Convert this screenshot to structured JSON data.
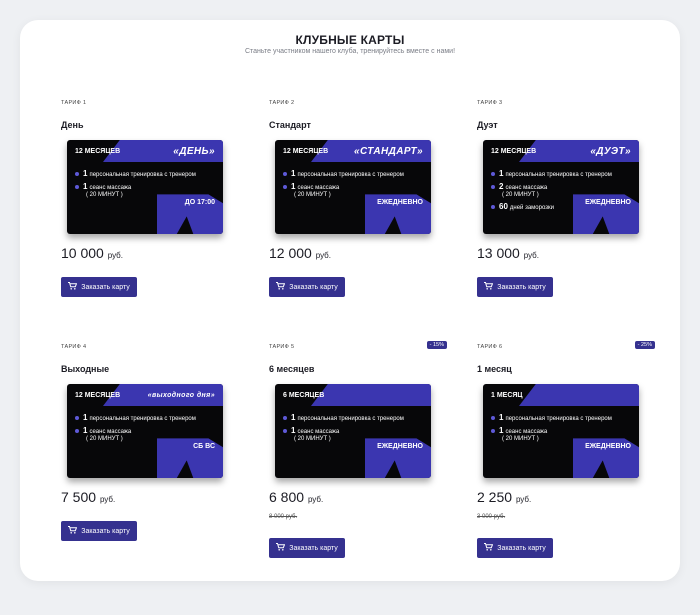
{
  "header": {
    "title": "КЛУБНЫЕ КАРТЫ",
    "subtitle": "Станьте участником нашего клуба, тренируйтесь вместе с нами!"
  },
  "tariffs": [
    {
      "tag": "ТАРИФ 1",
      "name": "День",
      "badge": "",
      "card": {
        "period": "12 МЕСЯЦЕВ",
        "plan": "«ДЕНЬ»",
        "items": [
          {
            "num": "1",
            "text": "персональная тренировка с тренером",
            "sub": ""
          },
          {
            "num": "1",
            "text": "сеанс массажа",
            "sub": "( 20 МИНУТ )"
          }
        ],
        "schedule": "ДО 17:00"
      },
      "price": "10 000",
      "currency": "руб.",
      "old_price": "",
      "button": "Заказать карту"
    },
    {
      "tag": "ТАРИФ 2",
      "name": "Стандарт",
      "badge": "",
      "card": {
        "period": "12 МЕСЯЦЕВ",
        "plan": "«СТАНДАРТ»",
        "items": [
          {
            "num": "1",
            "text": "персональная тренировка с тренером",
            "sub": ""
          },
          {
            "num": "1",
            "text": "сеанс массажа",
            "sub": "( 20 МИНУТ )"
          }
        ],
        "schedule": "ЕЖЕДНЕВНО"
      },
      "price": "12 000",
      "currency": "руб.",
      "old_price": "",
      "button": "Заказать карту"
    },
    {
      "tag": "ТАРИФ 3",
      "name": "Дуэт",
      "badge": "",
      "card": {
        "period": "12 МЕСЯЦЕВ",
        "plan": "«ДУЭТ»",
        "items": [
          {
            "num": "1",
            "text": "персональная тренировка с тренером",
            "sub": ""
          },
          {
            "num": "2",
            "text": "сеанс массажа",
            "sub": "( 20 МИНУТ )"
          },
          {
            "num": "60",
            "text": "дней заморозки",
            "sub": ""
          }
        ],
        "schedule": "ЕЖЕДНЕВНО"
      },
      "price": "13 000",
      "currency": "руб.",
      "old_price": "",
      "button": "Заказать карту"
    },
    {
      "tag": "ТАРИФ 4",
      "name": "Выходные",
      "badge": "",
      "card": {
        "period": "12 МЕСЯЦЕВ",
        "plan": "«выходного дня»",
        "items": [
          {
            "num": "1",
            "text": "персональная тренировка с тренером",
            "sub": ""
          },
          {
            "num": "1",
            "text": "сеанс массажа",
            "sub": "( 20 МИНУТ )"
          }
        ],
        "schedule": "СБ ВС"
      },
      "price": "7 500",
      "currency": "руб.",
      "old_price": "",
      "button": "Заказать карту"
    },
    {
      "tag": "ТАРИФ 5",
      "name": "6 месяцев",
      "badge": "- 15%",
      "card": {
        "period": "6 МЕСЯЦЕВ",
        "plan": "",
        "items": [
          {
            "num": "1",
            "text": "персональная тренировка с тренером",
            "sub": ""
          },
          {
            "num": "1",
            "text": "сеанс массажа",
            "sub": "( 20 МИНУТ )"
          }
        ],
        "schedule": "ЕЖЕДНЕВНО"
      },
      "price": "6 800",
      "currency": "руб.",
      "old_price": "8 000 руб.",
      "button": "Заказать карту"
    },
    {
      "tag": "ТАРИФ 6",
      "name": "1 месяц",
      "badge": "- 25%",
      "card": {
        "period": "1 МЕСЯЦ",
        "plan": "",
        "items": [
          {
            "num": "1",
            "text": "персональная тренировка с тренером",
            "sub": ""
          },
          {
            "num": "1",
            "text": "сеанс массажа",
            "sub": "( 20 МИНУТ )"
          }
        ],
        "schedule": "ЕЖЕДНЕВНО"
      },
      "price": "2 250",
      "currency": "руб.",
      "old_price": "3 000 руб.",
      "button": "Заказать карту"
    }
  ],
  "colors": {
    "accent": "#35318f",
    "card_bg": "#070709",
    "card_shape": "#3b36b0"
  },
  "icons": {
    "button": "cart-icon"
  }
}
